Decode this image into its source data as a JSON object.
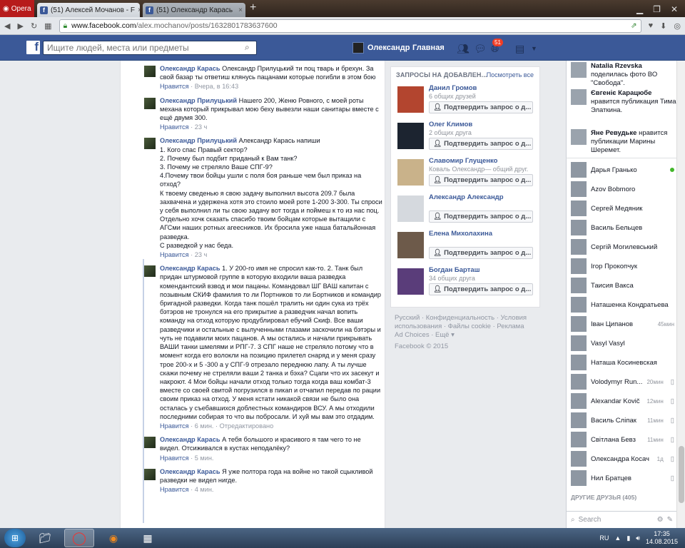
{
  "browser": {
    "opera_label": "Opera",
    "tabs": [
      {
        "label": "(51) Алексей Мочанов - F"
      },
      {
        "label": "(51) Олександр Карась"
      }
    ],
    "url_domain": "www.facebook.com",
    "url_path": "/alex.mochanov/posts/1632801783637600"
  },
  "fb": {
    "search_placeholder": "Ищите людей, места или предметы",
    "user_name": "Олександр",
    "home_label": "Главная",
    "notif_count": "51"
  },
  "comments": [
    {
      "author": "Олександр Карась",
      "text": "Олександр Прилуцький ти поц тварь и брехун. За свой базар ты ответиш клянусь пацанами которые погибли в этом бою",
      "like": "Нравится",
      "time": "Вчера, в 16:43",
      "edited": ""
    },
    {
      "author": "Олександр Прилуцький",
      "text": "Нашего 200, Женю Ровного, с моей роты механа который прикрывал мою беху вывезли наши санитары вместе с ещё двумя 300.",
      "like": "Нравится",
      "time": "23 ч",
      "edited": ""
    },
    {
      "author": "Олександр Прилуцький",
      "text": "Александр Карась напиши\n1. Кого спас Правый сектор?\n2. Почему был подбит приданый к Вам танк?\n3. Почему не стреляло Ваше СПГ-9?\n4.Почему твои бойцы ушли с поля боя раньше чем был приказ на отход?\nК твоему сведенью я свою задачу выполнил высота 209.7 была захвачена и удержена хотя это стоило моей роте 1-200 3-300. Ты спроси у себя выполнил ли ты свою задачу вот тогда и поймеш к то из нас поц.\nОтдельно хочк сказать спасибо твоим бойцам которые вытащили с АГСми наших ротных агеесников. Их бросила уже наша батальйонная разведка.\nС разведкой у нас беда.",
      "like": "Нравится",
      "time": "23 ч",
      "edited": ""
    },
    {
      "author": "Олександр Карась",
      "text": "1. У 200-го имя не спросил как-то. 2. Танк был придан штурмовой группе в которую входили ваша разведка комендантский взвод и мои пацаны. Командовал ШГ ВАШ капитан с позывным СКИФ фамилия то ли Портников то ли Бортников и командир бригадной разведки. Когда танк пошёл тралить ни один сука из трёх бэтэров не тронулся на его прикрытие а разведчик начал вопить команду на отход которую продублировал ебучий Скиф. Все ваши разведчики и остальные с вылученными глазами заскочили на бэтэры и чуть не подавили моих пацанов. А мы остались и начали прикрывать ВАШИ танки шмелями и РПГ-7. 3 СПГ наше не стреляло потому что в момент когда его волокли на позицию прилетел снаряд и у меня сразу трое 200-х и 5 -300 а у СПГ-9 отрезало переднюю лапу. А ты лучше скажи почему не стреляли ваши 2 танка и бэха? Сцапи что их засекут и накроют. 4 Мои бойцы начали отход только тогда когда ваш комбат-3 вместе со своей свитой погрузился в пикап и отчапил передав по рации своим приказ на отход. У меня кстати никакой связи не было она осталась у съебавшихся доблестных командиров ВСУ. А мы отходили последними собирая то что вы побросали. И хуй мы вам это отдадим.",
      "like": "Нравится",
      "time": "6 мин.",
      "edited": "Отредактировано"
    },
    {
      "author": "Олександр Карась",
      "text": "А тебя большого и красивого я там чего то не видел. Отсиживался в кустах неподалёку?",
      "like": "Нравится",
      "time": "5 мин.",
      "edited": ""
    },
    {
      "author": "Олександр Карась",
      "text": "Я уже полтора года на войне но такой сцыкливой разведки не видел нигде.",
      "like": "Нравится",
      "time": "4 мин.",
      "edited": ""
    }
  ],
  "friend_requests": {
    "heading": "ЗАПРОСЫ НА ДОБАВЛЕН...",
    "see_all": "Посмотреть все",
    "confirm_label": "Подтвердить запрос о д...",
    "items": [
      {
        "name": "Данил Громов",
        "sub": "6 общих друзей",
        "color": "#b3452f"
      },
      {
        "name": "Олег Климов",
        "sub": "2 общих друга",
        "color": "#1c2430"
      },
      {
        "name": "Славомир Глущенко",
        "sub": "Коваль Олександр— общий друг.",
        "color": "#c9b28a"
      },
      {
        "name": "Александр Александр",
        "sub": "",
        "color": "#d5d9de"
      },
      {
        "name": "Елена Михолахина",
        "sub": "",
        "color": "#6d5a4a"
      },
      {
        "name": "Богдан Барташ",
        "sub": "34 общих друга",
        "color": "#5a3d7a"
      }
    ]
  },
  "footer": {
    "line1": "Русский · Конфиденциальность · Условия",
    "line2": "использования · Файлы cookie · Реклама",
    "line3": "Ad Choices · Ещё ▾",
    "copyright": "Facebook © 2015"
  },
  "ticker": [
    {
      "name": "Natalia Rzevska",
      "text": "поделилась фото ВО \"Свобода\"."
    },
    {
      "name": "Євгеніє Карацюбе",
      "text": "нравится публикация Тима Элаткина."
    },
    {
      "name": "Яне Ревудьке",
      "text": "нравится публикации Марины Шеремет."
    }
  ],
  "chat": [
    {
      "name": "Дарья Гранько",
      "time": "",
      "online": true,
      "mobile": false
    },
    {
      "name": "Azov Bobmoro",
      "time": "",
      "online": false,
      "mobile": false
    },
    {
      "name": "Сергей Медяник",
      "time": "",
      "online": false,
      "mobile": false
    },
    {
      "name": "Василь Бельцев",
      "time": "",
      "online": false,
      "mobile": false
    },
    {
      "name": "Сергій Могилевський",
      "time": "",
      "online": false,
      "mobile": false
    },
    {
      "name": "Ігор Прокопчук",
      "time": "",
      "online": false,
      "mobile": false
    },
    {
      "name": "Таисия Вакса",
      "time": "",
      "online": false,
      "mobile": false
    },
    {
      "name": "Наташенка Кондратьева",
      "time": "",
      "online": false,
      "mobile": false
    },
    {
      "name": "Іван Ципанов",
      "time": "45мин",
      "online": false,
      "mobile": false
    },
    {
      "name": "Vasyl Vasyl",
      "time": "",
      "online": false,
      "mobile": false
    },
    {
      "name": "Наташа Косиневская",
      "time": "",
      "online": false,
      "mobile": false
    },
    {
      "name": "Volodymyr Run...",
      "time": "20мин",
      "online": false,
      "mobile": true
    },
    {
      "name": "Alexandar Kovič",
      "time": "12мин",
      "online": false,
      "mobile": true
    },
    {
      "name": "Василь Сліпак",
      "time": "11мин",
      "online": false,
      "mobile": true
    },
    {
      "name": "Світлана Бевз",
      "time": "11мин",
      "online": false,
      "mobile": true
    },
    {
      "name": "Олександра Косач",
      "time": "1д",
      "online": false,
      "mobile": true
    },
    {
      "name": "Нил Братцев",
      "time": "",
      "online": false,
      "mobile": true
    }
  ],
  "chat_more_label": "ДРУГИЕ ДРУЗЬЯ (405)",
  "chat_search": "Search",
  "taskbar": {
    "lang": "RU",
    "time": "17:35",
    "date": "14.08.2015"
  }
}
